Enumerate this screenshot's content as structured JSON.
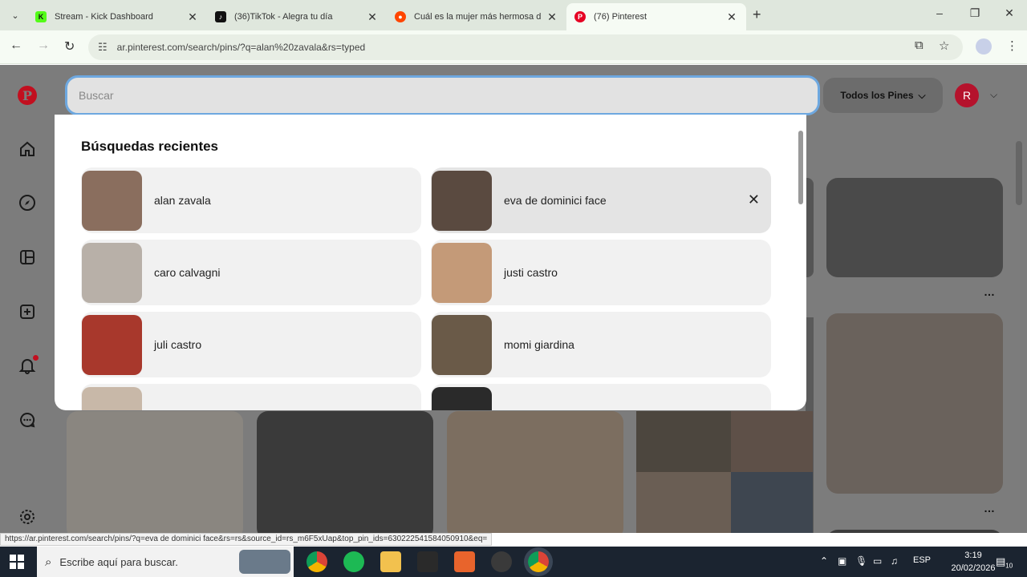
{
  "browser": {
    "tabs": [
      {
        "title": "Stream - Kick Dashboard",
        "icon": "kick-icon",
        "color": "#53fc18"
      },
      {
        "title": "(36)TikTok - Alegra tu día",
        "icon": "tiktok-icon",
        "color": "#111111"
      },
      {
        "title": "Cuál es la mujer más hermosa d",
        "icon": "reddit-icon",
        "color": "#ff4500"
      },
      {
        "title": "(76) Pinterest",
        "icon": "pinterest-icon",
        "color": "#e60023"
      }
    ],
    "url": "ar.pinterest.com/search/pins/?q=alan%20zavala&rs=typed"
  },
  "search": {
    "placeholder": "Buscar",
    "filter_label": "Todos los Pines",
    "avatar_initial": "R"
  },
  "recent": {
    "heading": "Búsquedas recientes",
    "items": [
      {
        "label": "alan zavala",
        "color": "#8a6e5e"
      },
      {
        "label": "eva de dominici face",
        "color": "#5a4a40",
        "hover": true
      },
      {
        "label": "caro calvagni",
        "color": "#b8b0a8"
      },
      {
        "label": "justi castro",
        "color": "#c49a78"
      },
      {
        "label": "juli castro",
        "color": "#a8382c"
      },
      {
        "label": "momi giardina",
        "color": "#6a5a48"
      }
    ]
  },
  "status_url": "https://ar.pinterest.com/search/pins/?q=eva de dominici face&rs=rs&source_id=rs_m6F5xUap&top_pin_ids=630222541584050910&eq=",
  "taskbar": {
    "search_placeholder": "Escribe aquí para buscar.",
    "language": "ESP",
    "time": "3:19",
    "date": "20/02/2026",
    "notifications": "10"
  },
  "colors": {
    "accent": "#e60023",
    "focus": "#6ea8e0"
  }
}
